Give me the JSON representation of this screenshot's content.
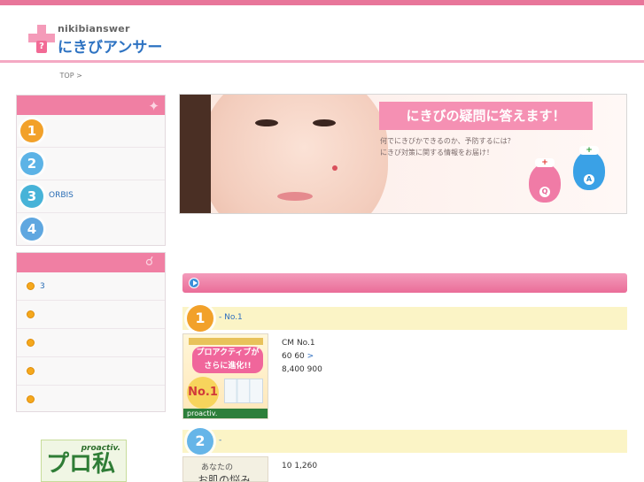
{
  "header": {
    "tagline": "",
    "logo_en": "nikibianswer",
    "logo_jp": "にきびアンサー",
    "logo_mark": "?"
  },
  "breadcrumb": {
    "home": "",
    "current": "TOP",
    "separator": ">"
  },
  "sidebar": {
    "ranking": {
      "heading": "",
      "items": [
        {
          "rank": "1",
          "label": ""
        },
        {
          "rank": "2",
          "label": ""
        },
        {
          "rank": "3",
          "label": "ORBIS"
        },
        {
          "rank": "4",
          "label": ""
        }
      ]
    },
    "menu": {
      "heading": "",
      "items": [
        {
          "label": "3"
        },
        {
          "label": ""
        },
        {
          "label": ""
        },
        {
          "label": ""
        },
        {
          "label": ""
        }
      ]
    },
    "banner": {
      "logo": "proactiv.",
      "text": "プロ私"
    }
  },
  "hero": {
    "title": "にきびの疑問に答えます！",
    "subtitle_line1": "何でにきびかできるのか、予防するには？",
    "subtitle_line2": "にきび対策に関する情報をお届け！",
    "bird_q_tag": "Q",
    "bird_a_tag": "A",
    "cap_symbol": "+"
  },
  "intro": "",
  "section": {
    "heading": ""
  },
  "products": [
    {
      "rank": "1",
      "title_a": "",
      "title_sep": " - ",
      "title_b": "No.1",
      "image": {
        "top_text": "",
        "bubble_line1": "プロアクティブが",
        "bubble_line2": "さらに進化!!",
        "badge": "No.1",
        "footer": "proactiv."
      },
      "desc_cm": "CM",
      "desc_no1": "No.1",
      "desc_60a": "60",
      "desc_60b": "60",
      "desc_link": ">",
      "price_a": "8,400",
      "price_b": "900"
    },
    {
      "rank": "2",
      "title_a": "",
      "title_sep": " - ",
      "title_b": "",
      "image": {
        "line1": "あなたの",
        "line2": "お肌の悩みは？"
      },
      "desc_a": "10",
      "desc_b": "1,260"
    }
  ],
  "colors": {
    "accent_pink": "#e8769a",
    "link_blue": "#2f6fc0",
    "rank1": "#f2a12a",
    "rank2": "#5cb3e6",
    "rank3": "#47b3d8",
    "rank4": "#5fa7e0"
  }
}
